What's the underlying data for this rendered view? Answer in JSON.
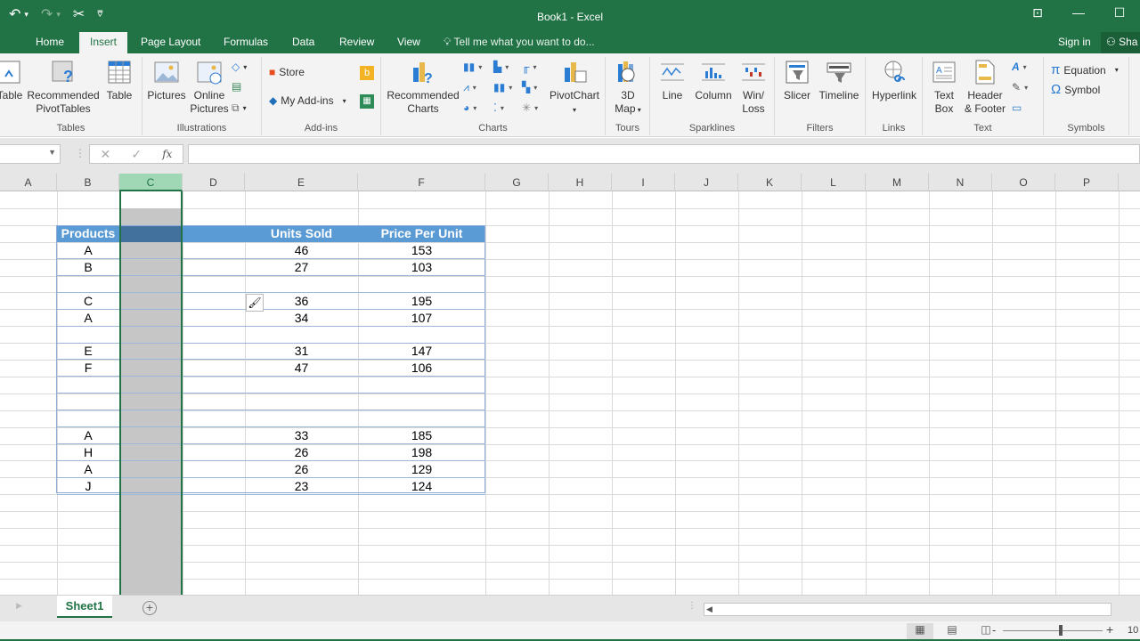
{
  "window": {
    "title": "Book1 - Excel",
    "quick_access": {
      "undo": "↶",
      "redo": "↷",
      "cut": "✂",
      "customize": "⩢"
    }
  },
  "tabs": [
    {
      "label": "Home",
      "active": false
    },
    {
      "label": "Insert",
      "active": true
    },
    {
      "label": "Page Layout",
      "active": false
    },
    {
      "label": "Formulas",
      "active": false
    },
    {
      "label": "Data",
      "active": false
    },
    {
      "label": "Review",
      "active": false
    },
    {
      "label": "View",
      "active": false
    }
  ],
  "tell_me": "Tell me what you want to do...",
  "account": {
    "sign_in": "Sign in",
    "share": "Sha"
  },
  "ribbon": {
    "groups": {
      "tables": {
        "label": "Tables",
        "pivot_table": "Table",
        "recommended_pivot_1": "Recommended",
        "recommended_pivot_2": "PivotTables",
        "table": "Table"
      },
      "illustrations": {
        "label": "Illustrations",
        "pictures": "Pictures",
        "online_1": "Online",
        "online_2": "Pictures"
      },
      "addins": {
        "label": "Add-ins",
        "store": "Store",
        "my_addins": "My Add-ins"
      },
      "charts": {
        "label": "Charts",
        "recommended_1": "Recommended",
        "recommended_2": "Charts",
        "pivotchart": "PivotChart"
      },
      "tours": {
        "label": "Tours",
        "map_1": "3D",
        "map_2": "Map"
      },
      "sparklines": {
        "label": "Sparklines",
        "line": "Line",
        "column": "Column",
        "winloss_1": "Win/",
        "winloss_2": "Loss"
      },
      "filters": {
        "label": "Filters",
        "slicer": "Slicer",
        "timeline": "Timeline"
      },
      "links": {
        "label": "Links",
        "hyperlink": "Hyperlink"
      },
      "text": {
        "label": "Text",
        "textbox_1": "Text",
        "textbox_2": "Box",
        "header_1": "Header",
        "header_2": "& Footer"
      },
      "symbols": {
        "label": "Symbols",
        "equation": "Equation",
        "symbol": "Symbol"
      }
    }
  },
  "formula_bar": {
    "name_box": "",
    "cancel": "✕",
    "enter": "✓",
    "fx": "fx",
    "value": ""
  },
  "columns": [
    "A",
    "B",
    "C",
    "D",
    "E",
    "F",
    "G",
    "H",
    "I",
    "J",
    "K",
    "L",
    "M",
    "N",
    "O",
    "P"
  ],
  "selected_column": "C",
  "table": {
    "headers": {
      "products": "Products",
      "units_sold": "Units Sold",
      "price_per_unit": "Price Per Unit"
    },
    "rows": [
      {
        "product": "A",
        "units": "46",
        "price": "153"
      },
      {
        "product": "B",
        "units": "27",
        "price": "103"
      },
      {
        "product": "",
        "units": "",
        "price": ""
      },
      {
        "product": "C",
        "units": "36",
        "price": "195"
      },
      {
        "product": "A",
        "units": "34",
        "price": "107"
      },
      {
        "product": "",
        "units": "",
        "price": ""
      },
      {
        "product": "E",
        "units": "31",
        "price": "147"
      },
      {
        "product": "F",
        "units": "47",
        "price": "106"
      },
      {
        "product": "",
        "units": "",
        "price": ""
      },
      {
        "product": "",
        "units": "",
        "price": ""
      },
      {
        "product": "",
        "units": "",
        "price": ""
      },
      {
        "product": "A",
        "units": "33",
        "price": "185"
      },
      {
        "product": "H",
        "units": "26",
        "price": "198"
      },
      {
        "product": "A",
        "units": "26",
        "price": "129"
      },
      {
        "product": "J",
        "units": "23",
        "price": "124"
      }
    ]
  },
  "sheets": [
    {
      "label": "Sheet1",
      "active": true
    }
  ],
  "add_sheet": "+",
  "status": {
    "zoom": "10"
  },
  "colors": {
    "brand": "#217346",
    "table_header": "#5b9bd5",
    "selection_fill": "#c6c6c6"
  }
}
